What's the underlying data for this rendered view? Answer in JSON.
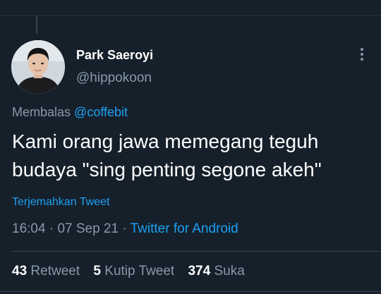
{
  "tweet": {
    "author": {
      "display_name": "Park Saeroyi",
      "handle": "@hippokoon"
    },
    "reply": {
      "prefix": "Membalas",
      "mention": "@coffebit"
    },
    "text_line1": "Kami orang jawa memegang teguh",
    "text_line2": "budaya \"sing penting segone akeh\"",
    "translate_label": "Terjemahkan Tweet",
    "time": "16:04",
    "date": "07 Sep 21",
    "separator": "·",
    "source": "Twitter for Android",
    "stats": {
      "retweets_count": "43",
      "retweets_label": "Retweet",
      "quotes_count": "5",
      "quotes_label": "Kutip Tweet",
      "likes_count": "374",
      "likes_label": "Suka"
    }
  },
  "icons": {
    "more": "more-vertical-icon",
    "avatar": "user-avatar"
  },
  "colors": {
    "background": "#15202b",
    "accent": "#1da1f2",
    "secondary_text": "#8899a6",
    "primary_text": "#ffffff",
    "divider": "#38444d"
  }
}
